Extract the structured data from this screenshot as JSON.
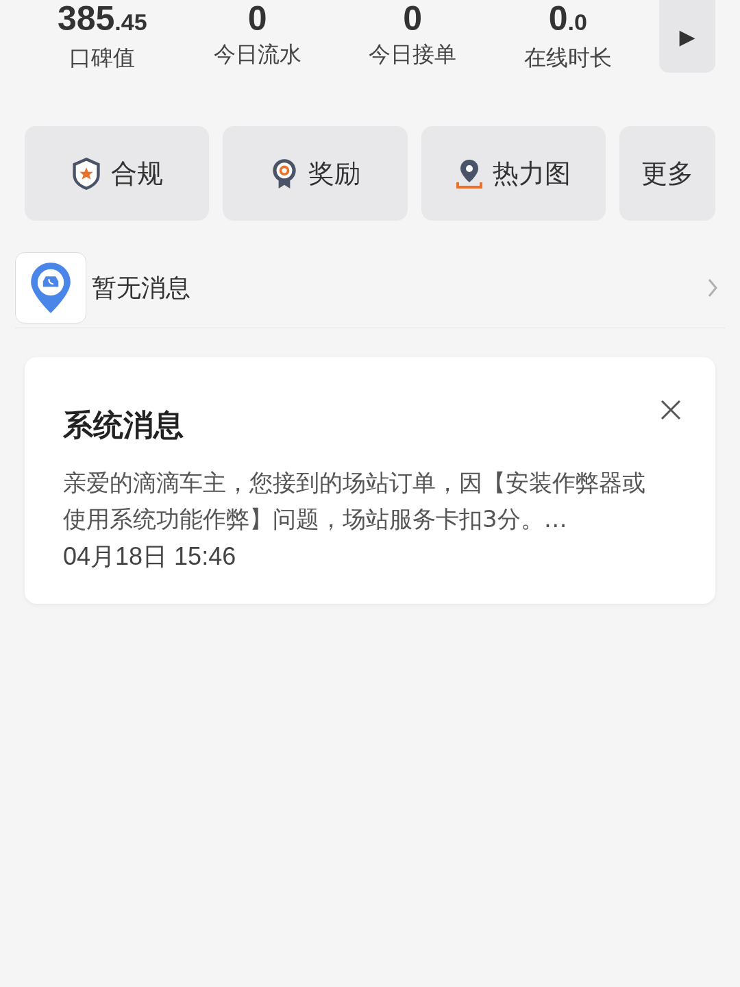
{
  "stats": [
    {
      "value": "385",
      "fraction": ".45",
      "label": "口碑值"
    },
    {
      "value": "0",
      "label": "今日流水"
    },
    {
      "value": "0",
      "label": "今日接单"
    },
    {
      "value": "0",
      "fraction": ".0",
      "label": "在线时长"
    }
  ],
  "stats_more": {
    "icon": "▶"
  },
  "shortcuts": [
    {
      "kind": "shield",
      "label": "合规"
    },
    {
      "kind": "medal",
      "label": "奖励"
    },
    {
      "kind": "pin",
      "label": "热力图"
    },
    {
      "kind": "more",
      "label": "更多"
    }
  ],
  "message_row": {
    "text": "暂无消息"
  },
  "system_card": {
    "title": "系统消息",
    "body": "亲爱的滴滴车主，您接到的场站订单，因【安装作弊器或使用系统功能作弊】问题，场站服务卡扣3分。…",
    "time": "04月18日 15:46"
  }
}
